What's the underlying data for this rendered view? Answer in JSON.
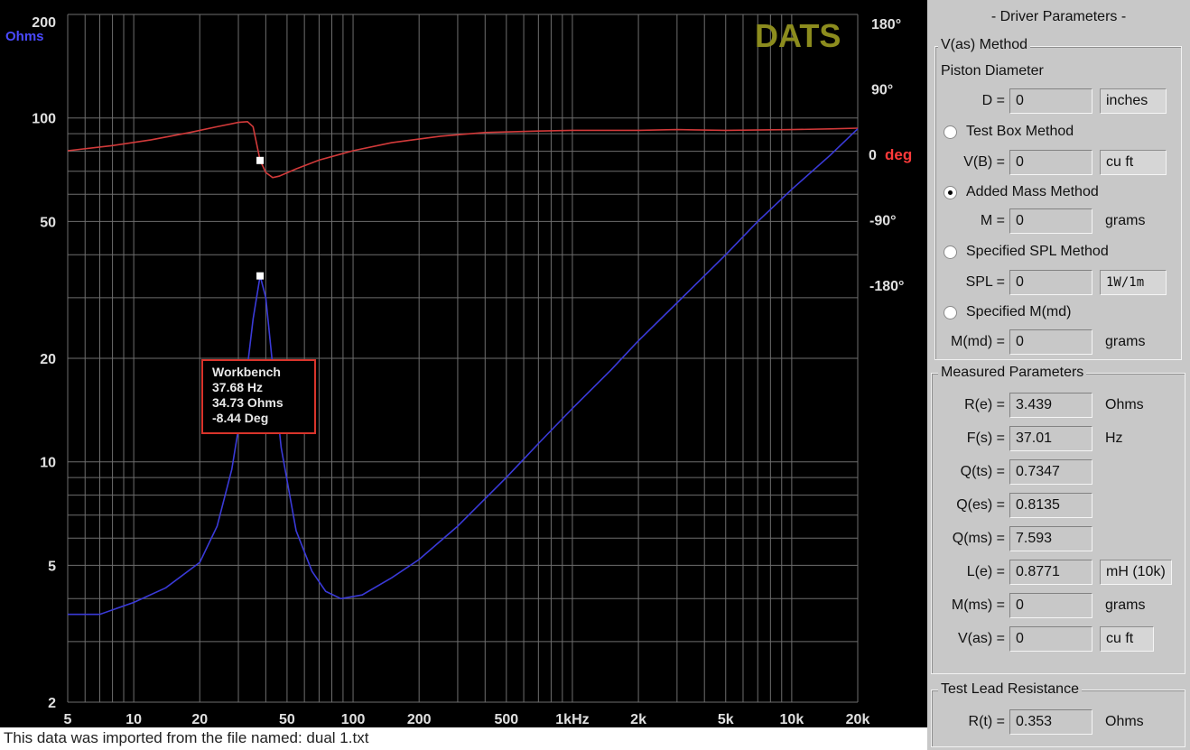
{
  "plot": {
    "brand": "DATS",
    "left_axis_unit": "Ohms",
    "left_ticks": [
      "200",
      "100",
      "50",
      "20",
      "10",
      "5",
      "2"
    ],
    "left_tick_values": [
      200,
      100,
      50,
      20,
      10,
      5,
      2
    ],
    "right_ticks": [
      "180°",
      "90°",
      "0",
      "-90°",
      "-180°"
    ],
    "right_tick_values": [
      180,
      90,
      0,
      -90,
      -180
    ],
    "right_axis_unit": "deg",
    "x_ticks": [
      "5",
      "10",
      "20",
      "50",
      "100",
      "200",
      "500",
      "1kHz",
      "2k",
      "5k",
      "10k",
      "20k"
    ],
    "x_tick_values": [
      5,
      10,
      20,
      50,
      100,
      200,
      500,
      1000,
      2000,
      5000,
      10000,
      20000
    ],
    "colors": {
      "impedance": "#3a3ad8",
      "phase": "#d23a3a",
      "grid": "#6e6e6e",
      "brand": "#8c8c1e"
    },
    "marker": {
      "title": "Workbench",
      "freq": "37.68 Hz",
      "impedance": "34.73 Ohms",
      "phase": "-8.44 Deg",
      "freq_value": 37.68,
      "impedance_value": 34.73,
      "phase_value": -8.44
    }
  },
  "chart_data": {
    "type": "line",
    "x_scale": "log",
    "xlim": [
      5,
      20000
    ],
    "ylim_left": [
      2,
      200
    ],
    "y_scale_left": "log",
    "ylim_right": [
      -180,
      180
    ],
    "series": [
      {
        "name": "Ohms",
        "axis": "left",
        "points": [
          [
            5,
            3.6
          ],
          [
            7,
            3.6
          ],
          [
            10,
            3.9
          ],
          [
            14,
            4.3
          ],
          [
            20,
            5.1
          ],
          [
            24,
            6.5
          ],
          [
            28,
            9.5
          ],
          [
            32,
            16
          ],
          [
            35,
            26
          ],
          [
            37.68,
            34.73
          ],
          [
            40,
            30
          ],
          [
            43,
            19
          ],
          [
            47,
            11
          ],
          [
            55,
            6.3
          ],
          [
            65,
            4.8
          ],
          [
            75,
            4.2
          ],
          [
            88,
            4.0
          ],
          [
            110,
            4.1
          ],
          [
            150,
            4.6
          ],
          [
            200,
            5.2
          ],
          [
            300,
            6.5
          ],
          [
            500,
            9.0
          ],
          [
            700,
            11.3
          ],
          [
            1000,
            14.3
          ],
          [
            1500,
            18.5
          ],
          [
            2000,
            22.5
          ],
          [
            3000,
            29
          ],
          [
            5000,
            40
          ],
          [
            7000,
            50
          ],
          [
            10000,
            62
          ],
          [
            15000,
            78
          ],
          [
            20000,
            93
          ]
        ]
      },
      {
        "name": "deg",
        "axis": "right",
        "points": [
          [
            5,
            5
          ],
          [
            8,
            12
          ],
          [
            12,
            20
          ],
          [
            18,
            30
          ],
          [
            24,
            38
          ],
          [
            30,
            44
          ],
          [
            33,
            45
          ],
          [
            35,
            38
          ],
          [
            37.68,
            -8.44
          ],
          [
            40,
            -25
          ],
          [
            43,
            -32
          ],
          [
            46,
            -30
          ],
          [
            55,
            -20
          ],
          [
            70,
            -8
          ],
          [
            100,
            5
          ],
          [
            150,
            16
          ],
          [
            250,
            25
          ],
          [
            400,
            30
          ],
          [
            700,
            32
          ],
          [
            1000,
            33
          ],
          [
            2000,
            33
          ],
          [
            3000,
            34
          ],
          [
            5000,
            33
          ],
          [
            10000,
            34
          ],
          [
            15000,
            35
          ],
          [
            20000,
            36
          ]
        ]
      }
    ]
  },
  "footer": "This data was imported from the file named: dual 1.txt",
  "panel": {
    "title": "- Driver Parameters -",
    "vas_method": {
      "legend": "V(as) Method",
      "piston_label": "Piston Diameter",
      "d_label": "D =",
      "d_value": "0",
      "d_unit": "inches",
      "test_box_label": "Test Box Method",
      "vb_label": "V(B) =",
      "vb_value": "0",
      "vb_unit": "cu ft",
      "added_mass_label": "Added Mass Method",
      "m_label": "M =",
      "m_value": "0",
      "m_unit": "grams",
      "spl_method_label": "Specified SPL Method",
      "spl_label": "SPL =",
      "spl_value": "0",
      "spl_unit": "1W/1m",
      "mmd_method_label": "Specified M(md)",
      "mmd_label": "M(md) =",
      "mmd_value": "0",
      "mmd_unit": "grams",
      "selected": "added_mass"
    },
    "measured": {
      "legend": "Measured Parameters",
      "rows": [
        {
          "label": "R(e) =",
          "value": "3.439",
          "unit": "Ohms"
        },
        {
          "label": "F(s) =",
          "value": "37.01",
          "unit": "Hz"
        },
        {
          "label": "Q(ts) =",
          "value": "0.7347",
          "unit": ""
        },
        {
          "label": "Q(es) =",
          "value": "0.8135",
          "unit": ""
        },
        {
          "label": "Q(ms) =",
          "value": "7.593",
          "unit": ""
        },
        {
          "label": "L(e) =",
          "value": "0.8771",
          "unit": "mH (10k)"
        },
        {
          "label": "M(ms) =",
          "value": "0",
          "unit": "grams"
        },
        {
          "label": "V(as) =",
          "value": "0",
          "unit": "cu ft"
        }
      ]
    },
    "lead": {
      "legend": "Test Lead Resistance",
      "label": "R(t) =",
      "value": "0.353",
      "unit": "Ohms"
    }
  }
}
